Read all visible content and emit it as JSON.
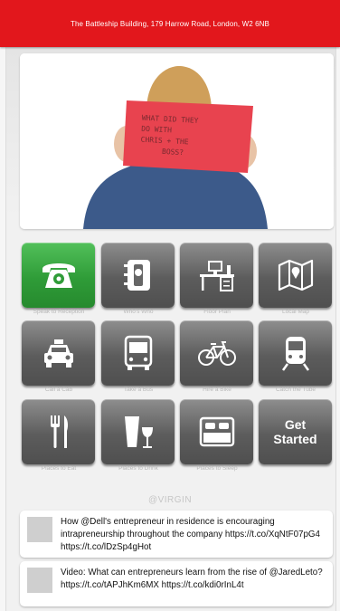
{
  "header": {
    "address": "The Battleship Building, 179 Harrow Road, London, W2 6NB"
  },
  "hero": {
    "sign_text": "WHAT DID THEY DO WITH CHRIS + THE BOSS?",
    "colors": {
      "sign": "#e8434f",
      "shirt": "#3c5a8a",
      "hair": "#cf9f5a"
    }
  },
  "tiles": [
    {
      "label": "Speak to Reception",
      "icon": "phone-icon"
    },
    {
      "label": "Who's Who",
      "icon": "address-book-icon"
    },
    {
      "label": "Floor Plan",
      "icon": "desk-icon"
    },
    {
      "label": "Local Map",
      "icon": "map-icon"
    },
    {
      "label": "Call a Cab",
      "icon": "taxi-icon"
    },
    {
      "label": "Take a Bus",
      "icon": "bus-icon"
    },
    {
      "label": "Hire a Bike",
      "icon": "bike-icon"
    },
    {
      "label": "Catch the Tube",
      "icon": "train-icon"
    },
    {
      "label": "Places to Eat",
      "icon": "cutlery-icon"
    },
    {
      "label": "Places to Drink",
      "icon": "drinks-icon"
    },
    {
      "label": "Places to Sleep",
      "icon": "bed-icon"
    },
    {
      "label": "Get Started",
      "icon": ""
    }
  ],
  "get_started": {
    "line1": "Get",
    "line2": "Started"
  },
  "feed": {
    "handle": "@VIRGIN",
    "tweets": [
      {
        "text": "How @Dell's entrepreneur in residence is encouraging intrapreneurship throughout the company https://t.co/XqNtF07pG4 https://t.co/lDzSp4gHot"
      },
      {
        "text": "Video: What can entrepreneurs learn from the rise of @JaredLeto? https://t.co/tAPJhKm6MX https://t.co/kdi0rInL4t"
      }
    ]
  },
  "colors": {
    "brand_red": "#e2171c",
    "reception_green": "#2f9c38",
    "tile_gray": "#5c5c5c"
  }
}
